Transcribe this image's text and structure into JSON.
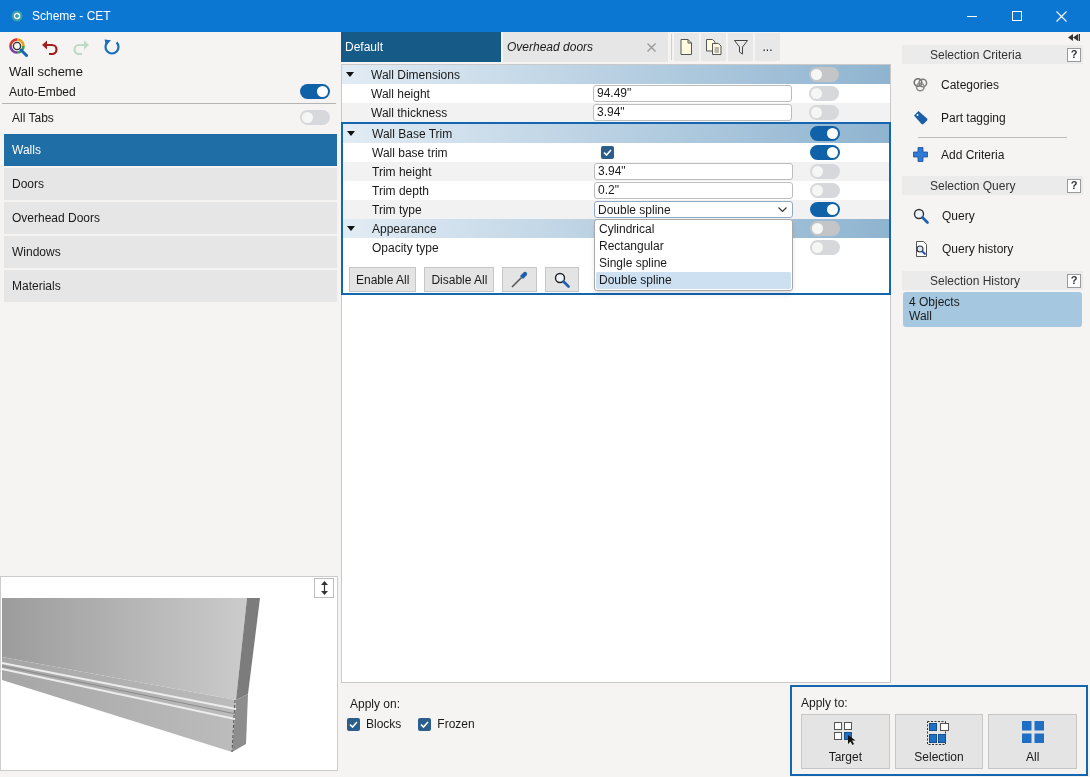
{
  "window": {
    "title": "Scheme - CET"
  },
  "toolbar": [
    {
      "disabled": false
    },
    {
      "disabled": false
    },
    {
      "disabled": true
    },
    {
      "disabled": false
    }
  ],
  "scheme": {
    "name": "Wall scheme",
    "auto_embed": {
      "label": "Auto-Embed",
      "on": true
    },
    "all_tabs": {
      "label": "All Tabs",
      "on": false
    }
  },
  "categories": [
    {
      "label": "Walls",
      "selected": true
    },
    {
      "label": "Doors",
      "selected": false
    },
    {
      "label": "Overhead Doors",
      "selected": false
    },
    {
      "label": "Windows",
      "selected": false
    },
    {
      "label": "Materials",
      "selected": false
    }
  ],
  "tabs": [
    {
      "label": "Default",
      "selected": true,
      "italic": false,
      "closable": false
    },
    {
      "label": "Overhead doors",
      "selected": false,
      "italic": true,
      "closable": true
    }
  ],
  "tab_tools": {
    "more": "..."
  },
  "property_groups": [
    {
      "title": "Wall Dimensions",
      "expanded": true,
      "on": false,
      "framed": false,
      "properties": [
        {
          "label": "Wall height",
          "kind": "text",
          "value": "94.49\"",
          "on": false
        },
        {
          "label": "Wall thickness",
          "kind": "text",
          "value": "3.94\"",
          "on": false
        }
      ]
    },
    {
      "title": "Wall Base Trim",
      "expanded": true,
      "on": true,
      "framed": true,
      "properties": [
        {
          "label": "Wall base trim",
          "kind": "checkbox",
          "checked": true,
          "on": true
        },
        {
          "label": "Trim height",
          "kind": "text",
          "value": "3.94\"",
          "on": false
        },
        {
          "label": "Trim depth",
          "kind": "text",
          "value": "0.2\"",
          "on": false
        },
        {
          "label": "Trim type",
          "kind": "select",
          "value": "Double spline",
          "expanded": true,
          "on": true,
          "options": [
            {
              "label": "Cylindrical",
              "selected": false
            },
            {
              "label": "Rectangular",
              "selected": false
            },
            {
              "label": "Single spline",
              "selected": false
            },
            {
              "label": "Double spline",
              "selected": true
            }
          ]
        }
      ]
    },
    {
      "title": "Appearance",
      "expanded": true,
      "on": false,
      "framed": true,
      "properties": [
        {
          "label": "Opacity type",
          "kind": "select",
          "on": false
        }
      ]
    }
  ],
  "grid_actions": [
    {
      "label": "Enable All"
    },
    {
      "label": "Disable All"
    }
  ],
  "apply_on": {
    "label": "Apply on:",
    "options": [
      {
        "label": "Blocks",
        "checked": true
      },
      {
        "label": "Frozen",
        "checked": true
      }
    ]
  },
  "apply_to": {
    "label": "Apply to:",
    "framed": true,
    "buttons": [
      {
        "label": "Target"
      },
      {
        "label": "Selection"
      },
      {
        "label": "All"
      }
    ]
  },
  "side_panel": {
    "sections": [
      {
        "title": "Selection Criteria",
        "help": "?",
        "items": [
          {
            "label": "Categories"
          },
          {
            "label": "Part tagging"
          }
        ],
        "action": {
          "label": "Add Criteria"
        }
      },
      {
        "title": "Selection Query",
        "help": "?",
        "items": [
          {
            "label": "Query"
          },
          {
            "label": "Query history"
          }
        ]
      },
      {
        "title": "Selection History",
        "help": "?",
        "entries": [
          {
            "title": "4 Objects",
            "detail": "Wall",
            "selected": true
          }
        ]
      }
    ]
  }
}
